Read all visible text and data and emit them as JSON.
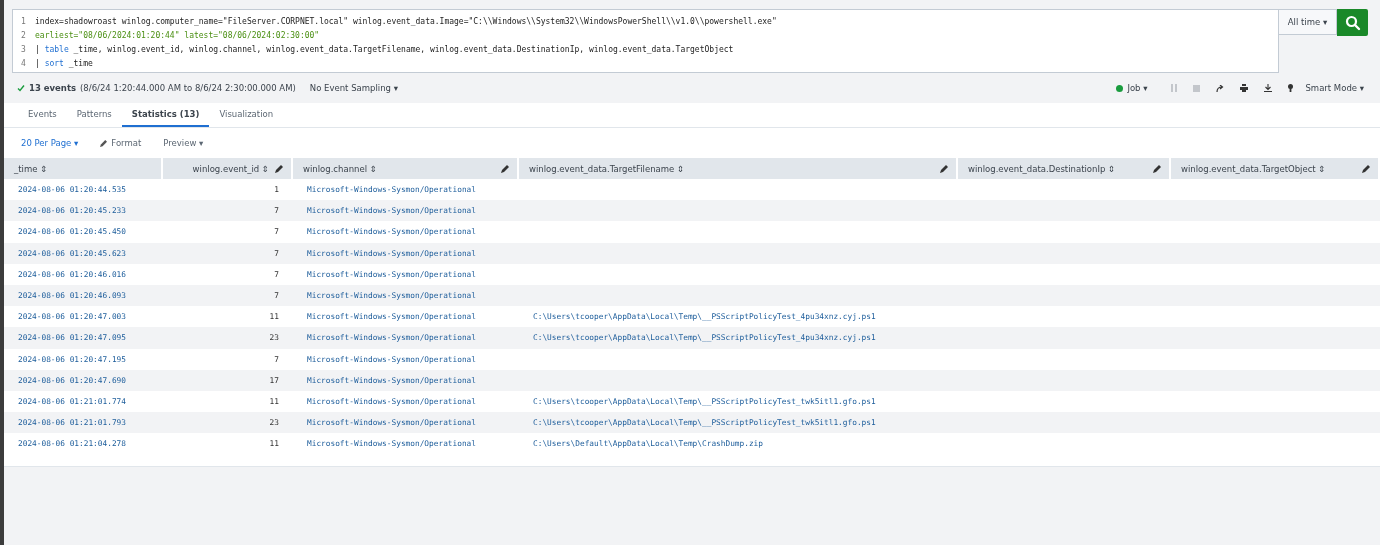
{
  "search": {
    "lines": [
      {
        "number": "1",
        "tokens": [
          {
            "kind": "text",
            "text": "index=shadowroast winlog.computer_name=\"FileServer.CORPNET.local\" winlog.event_data.Image=\"C:\\\\Windows\\\\System32\\\\WindowsPowerShell\\\\v1.0\\\\powershell.exe\""
          }
        ]
      },
      {
        "number": "2",
        "tokens": [
          {
            "kind": "argument",
            "text": "earliest=\"08/06/2024:01:20:44\" latest=\"08/06/2024:02:30:00\""
          }
        ]
      },
      {
        "number": "3",
        "tokens": [
          {
            "kind": "text",
            "text": "| "
          },
          {
            "kind": "command",
            "text": "table"
          },
          {
            "kind": "text",
            "text": " _time, winlog.event_id, winlog.channel, winlog.event_data.TargetFilename, winlog.event_data.DestinationIp, winlog.event_data.TargetObject"
          }
        ]
      },
      {
        "number": "4",
        "tokens": [
          {
            "kind": "text",
            "text": "| "
          },
          {
            "kind": "command",
            "text": "sort"
          },
          {
            "kind": "text",
            "text": " _time"
          }
        ]
      }
    ],
    "time_range": "All time ▾"
  },
  "status": {
    "count": "13 events",
    "range": "(8/6/24 1:20:44.000 AM to 8/6/24 2:30:00.000 AM)",
    "sampling": "No Event Sampling ▾",
    "job": "Job ▾",
    "mode": "Smart Mode ▾"
  },
  "tabs": [
    {
      "label": "Events",
      "selected": false
    },
    {
      "label": "Patterns",
      "selected": false
    },
    {
      "label": "Statistics (13)",
      "selected": true
    },
    {
      "label": "Visualization",
      "selected": false
    }
  ],
  "toolbar": {
    "per_page": "20 Per Page ▾",
    "format": "Format",
    "preview": "Preview ▾"
  },
  "table": {
    "columns": [
      {
        "label": "_time ⇕",
        "kind": "time"
      },
      {
        "label": "winlog.event_id ⇕",
        "kind": "number"
      },
      {
        "label": "winlog.channel ⇕",
        "kind": "text"
      },
      {
        "label": "winlog.event_data.TargetFilename ⇕",
        "kind": "text"
      },
      {
        "label": "winlog.event_data.DestinationIp ⇕",
        "kind": "text"
      },
      {
        "label": "winlog.event_data.TargetObject ⇕",
        "kind": "text"
      }
    ],
    "rows": [
      [
        "2024-08-06 01:20:44.535",
        "1",
        "Microsoft-Windows-Sysmon/Operational",
        ""
      ],
      [
        "2024-08-06 01:20:45.233",
        "7",
        "Microsoft-Windows-Sysmon/Operational",
        ""
      ],
      [
        "2024-08-06 01:20:45.450",
        "7",
        "Microsoft-Windows-Sysmon/Operational",
        ""
      ],
      [
        "2024-08-06 01:20:45.623",
        "7",
        "Microsoft-Windows-Sysmon/Operational",
        ""
      ],
      [
        "2024-08-06 01:20:46.016",
        "7",
        "Microsoft-Windows-Sysmon/Operational",
        ""
      ],
      [
        "2024-08-06 01:20:46.093",
        "7",
        "Microsoft-Windows-Sysmon/Operational",
        ""
      ],
      [
        "2024-08-06 01:20:47.003",
        "11",
        "Microsoft-Windows-Sysmon/Operational",
        "C:\\Users\\tcooper\\AppData\\Local\\Temp\\__PSScriptPolicyTest_4pu34xnz.cyj.ps1"
      ],
      [
        "2024-08-06 01:20:47.095",
        "23",
        "Microsoft-Windows-Sysmon/Operational",
        "C:\\Users\\tcooper\\AppData\\Local\\Temp\\__PSScriptPolicyTest_4pu34xnz.cyj.ps1"
      ],
      [
        "2024-08-06 01:20:47.195",
        "7",
        "Microsoft-Windows-Sysmon/Operational",
        ""
      ],
      [
        "2024-08-06 01:20:47.690",
        "17",
        "Microsoft-Windows-Sysmon/Operational",
        ""
      ],
      [
        "2024-08-06 01:21:01.774",
        "11",
        "Microsoft-Windows-Sysmon/Operational",
        "C:\\Users\\tcooper\\AppData\\Local\\Temp\\__PSScriptPolicyTest_twk5itl1.gfo.ps1"
      ],
      [
        "2024-08-06 01:21:01.793",
        "23",
        "Microsoft-Windows-Sysmon/Operational",
        "C:\\Users\\tcooper\\AppData\\Local\\Temp\\__PSScriptPolicyTest_twk5itl1.gfo.ps1"
      ],
      [
        "2024-08-06 01:21:04.278",
        "11",
        "Microsoft-Windows-Sysmon/Operational",
        "C:\\Users\\Default\\AppData\\Local\\Temp\\CrashDump.zip"
      ]
    ]
  }
}
